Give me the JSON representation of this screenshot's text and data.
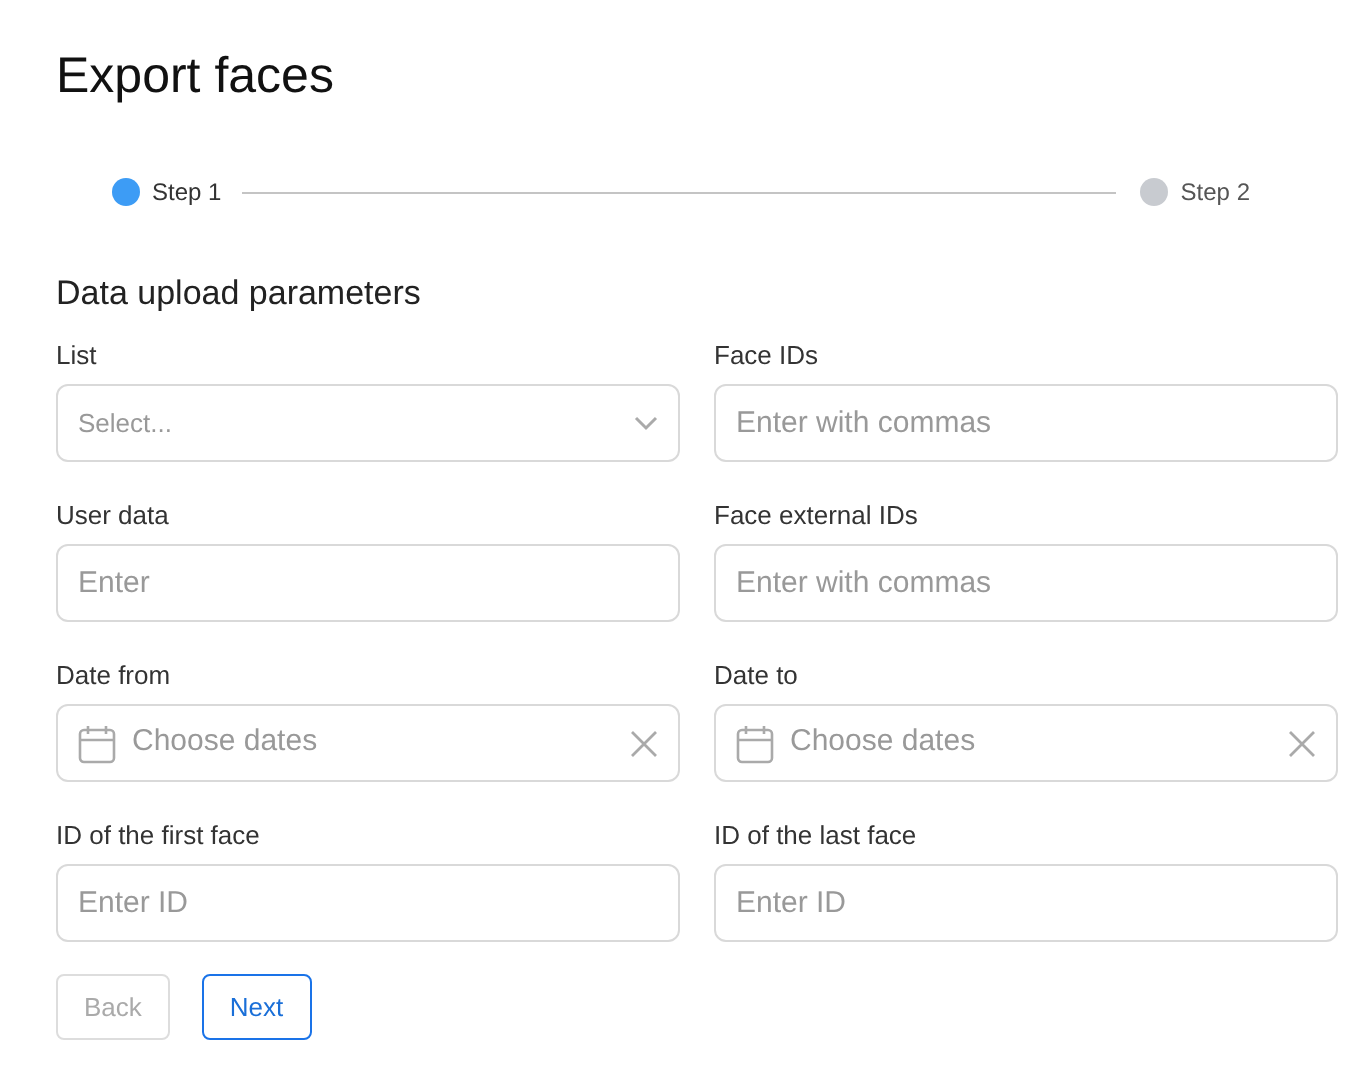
{
  "title": "Export faces",
  "steps": [
    {
      "label": "Step 1",
      "selected": true
    },
    {
      "label": "Step 2",
      "selected": false
    }
  ],
  "section_title": "Data upload parameters",
  "fields": [
    {
      "label": "List",
      "kind": "select",
      "placeholder": "Select..."
    },
    {
      "label": "Face IDs",
      "kind": "text",
      "placeholder": "Enter with commas"
    },
    {
      "label": "User data",
      "kind": "text",
      "placeholder": "Enter"
    },
    {
      "label": "Face external IDs",
      "kind": "text",
      "placeholder": "Enter with commas"
    },
    {
      "label": "Date from",
      "kind": "date",
      "placeholder": "Choose dates"
    },
    {
      "label": "Date to",
      "kind": "date",
      "placeholder": "Choose dates"
    },
    {
      "label": "ID of the first face",
      "kind": "text",
      "placeholder": "Enter ID"
    },
    {
      "label": "ID of the last face",
      "kind": "text",
      "placeholder": "Enter ID"
    }
  ],
  "buttons": [
    {
      "label": "Back",
      "disabled": true
    },
    {
      "label": "Next",
      "disabled": false
    }
  ]
}
